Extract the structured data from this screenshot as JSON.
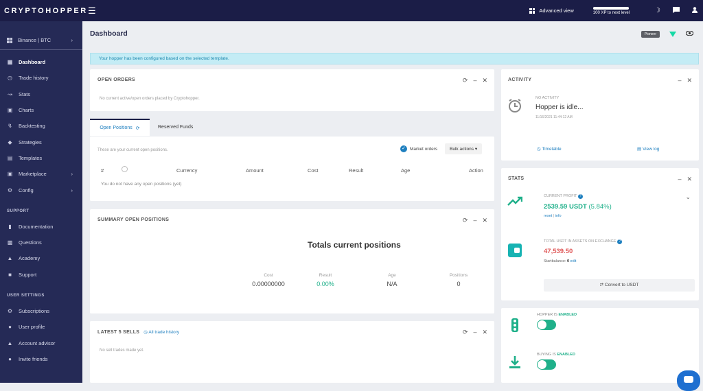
{
  "topbar": {
    "logo": "CRYPTOHOPPER",
    "advanced_view": "Advanced view",
    "xp_text": "100 XP to next level"
  },
  "sidebar": {
    "exchange": "Binance | BTC",
    "items": [
      {
        "label": "Dashboard",
        "icon": "dashboard-icon"
      },
      {
        "label": "Trade history",
        "icon": "clock-icon"
      },
      {
        "label": "Stats",
        "icon": "trend-icon"
      },
      {
        "label": "Charts",
        "icon": "chart-icon"
      },
      {
        "label": "Backtesting",
        "icon": "backtest-icon"
      },
      {
        "label": "Strategies",
        "icon": "strategy-icon"
      },
      {
        "label": "Templates",
        "icon": "template-icon"
      },
      {
        "label": "Marketplace",
        "icon": "cart-icon"
      },
      {
        "label": "Config",
        "icon": "gear-icon"
      }
    ],
    "support_heading": "SUPPORT",
    "support_items": [
      "Documentation",
      "Questions",
      "Academy",
      "Support"
    ],
    "user_heading": "USER SETTINGS",
    "user_items": [
      "Subscriptions",
      "User profile",
      "Account advisor",
      "Invite friends"
    ]
  },
  "page": {
    "title": "Dashboard",
    "badge": "Pioneer",
    "alert": "Your hopper has been configured based on the selected template."
  },
  "open_orders": {
    "title": "OPEN ORDERS",
    "empty": "No current active/open orders placed by Cryptohopper."
  },
  "positions": {
    "tab_open": "Open Positions",
    "tab_reserved": "Reserved Funds",
    "desc": "These are your current open positions.",
    "market_orders": "Market orders",
    "bulk_actions": "Bulk actions",
    "columns": [
      "#",
      "Currency",
      "Amount",
      "Cost",
      "Result",
      "Age",
      "Action"
    ],
    "empty": "You do not have any open positions (yet)"
  },
  "summary": {
    "title": "SUMMARY OPEN POSITIONS",
    "heading": "Totals current positions",
    "cols": [
      {
        "label": "Cost",
        "value": "0.00000000"
      },
      {
        "label": "Result",
        "value": "0.00%"
      },
      {
        "label": "Age",
        "value": "N/A"
      },
      {
        "label": "Positions",
        "value": "0"
      }
    ]
  },
  "latest_sells": {
    "title": "LATEST 5 SELLS",
    "link": "All trade history",
    "empty": "No sell trades made yet."
  },
  "activity": {
    "title": "ACTIVITY",
    "subtitle": "NO ACTIVITY",
    "status": "Hopper is idle...",
    "time": "11/16/2021 11:44:12 AM",
    "timetable": "Timetable",
    "view_log": "View log"
  },
  "stats": {
    "title": "STATS",
    "profit_label": "CURRENT PROFIT",
    "profit_value": "2539.59 USDT",
    "profit_pct": "(5.84%)",
    "reset": "reset",
    "info": "info",
    "assets_label": "TOTAL USDT IN ASSETS ON EXCHANGE",
    "assets_value": "47,539.50",
    "start_balance": "Startbalance:",
    "start_value": "0",
    "edit": "edit",
    "convert": "Convert to USDT"
  },
  "status_card": {
    "hopper_label": "HOPPER IS",
    "hopper_state": "ENABLED",
    "buying_label": "BUYING IS",
    "buying_state": "ENABLED"
  },
  "colors": {
    "topbar": "#1b1d47",
    "sidebar": "#252a56",
    "accent_green": "#1fb08a",
    "danger": "#e05a5a"
  }
}
